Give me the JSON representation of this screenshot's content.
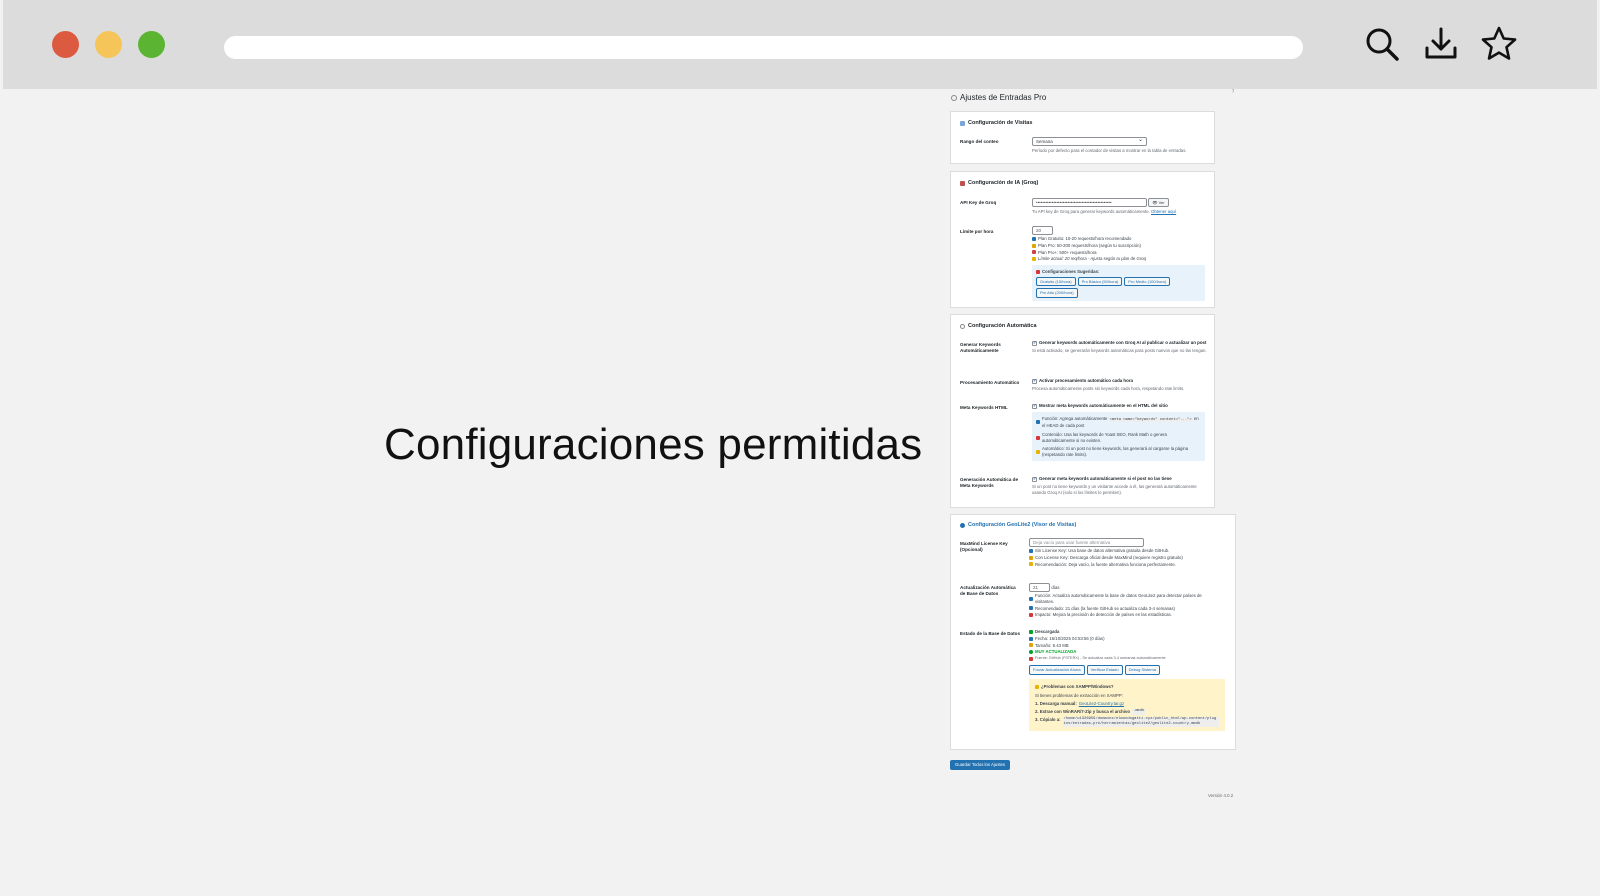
{
  "headline": "Configuraciones permitidas",
  "browser": {
    "icons": [
      "search-icon",
      "download-icon",
      "star-icon"
    ],
    "colors": {
      "close": "#dc5a3f",
      "minimize": "#f6c55a",
      "maximize": "#5bb532"
    }
  },
  "settings": {
    "title": "Ajustes de Entradas Pro",
    "visits": {
      "title": "Configuración de Visitas",
      "range_label": "Rango del conteo",
      "range_value": "Semana",
      "range_help": "Período por defecto para el contador de visitas a mostrar en la tabla de entradas."
    },
    "ia": {
      "title": "Configuración de IA (Groq)",
      "api_label": "API Key de Groq",
      "api_value": "••••••••••••••••••••••••••••••••••••••••••••••••",
      "show_button": "👁 Ver",
      "api_help": "Tu API key de Groq para generar keywords automáticamente.",
      "api_link": "Obtener aquí",
      "limit_label": "Límite por hora",
      "limit_value": "20",
      "plans": [
        "Plan Gratuito: 10-20 requests/hora recomendado",
        "Plan Pro: 50-200 requests/hora (según tu suscripción)",
        "Plan Pro+: 500+ requests/hora",
        "Límite actual: 20 req/hora - Ajusta según tu plan de Groq"
      ],
      "suggested_title": "Configuraciones Sugeridas:",
      "suggested": [
        "Gratuito (15/hora)",
        "Pro Básico (50/hora)",
        "Pro Medio (100/hora)",
        "Pro Alto (200/hora)"
      ]
    },
    "auto": {
      "title": "Configuración Automática",
      "gen_label": "Generar Keywords Automáticamente",
      "gen_check": "Generar keywords automáticamente con Groq AI al publicar o actualizar un post",
      "gen_help": "Si está activado, se generarán keywords automáticas para posts nuevos que no las tengan.",
      "proc_label": "Procesamiento Automático",
      "proc_check": "Activar procesamiento automático cada hora",
      "proc_help": "Procesa automáticamente posts sin keywords cada hora, respetando rate limits.",
      "meta_label": "Meta Keywords HTML",
      "meta_check": "Mostrar meta keywords automáticamente en el HTML del sitio",
      "meta_func_a": "Función: Agrega automáticamente",
      "meta_func_code": "<meta name=\"keywords\" content=\"...\">",
      "meta_func_b": "en el HEAD de cada post",
      "meta_content": "Contenido: Usa las keywords de Yoast SEO, Rank Math o genera automáticamente si no existen.",
      "meta_auto": "Automático: Si un post no tiene keywords, las generará al cargarse la página (respetando rate limits).",
      "genmeta_label": "Generación Automática de Meta Keywords",
      "genmeta_check": "Generar meta keywords automáticamente si el post no las tiene",
      "genmeta_help": "Si un post no tiene keywords y un visitante accede a él, las generará automáticamente usando Groq AI (solo si los límites lo permiten)."
    },
    "geo": {
      "title": "Configuración GeoLite2 (Visor de Visitas)",
      "license_label": "MaxMind License Key (Opcional)",
      "license_placeholder": "Deja vacío para usar fuente alternativa",
      "license_lines": [
        "Sin License Key: Usa base de datos alternativa gratuita desde GitHub.",
        "Con License Key: Descarga oficial desde MaxMind (requiere registro gratuito)",
        "Recomendación: Deja vacío, la fuente alternativa funciona perfectamente."
      ],
      "update_label": "Actualización Automática de Base de Datos",
      "update_value": "21",
      "update_unit": "días",
      "update_lines": [
        "Función: Actualiza automáticamente la base de datos GeoLite2 para detectar países de visitantes.",
        "Recomendado: 21 días (la fuente GitHub se actualiza cada 3-4 semanas)",
        "Impacto: Mejora la precisión de detección de países en las estadísticas."
      ],
      "status_label": "Estado de la Base de Datos",
      "status_lines": [
        "Descargada",
        "Fecha: 16/10/2025 04:53:56 (0 días)",
        "Tamaño: 9.43 MB",
        "MUY ACTUALIZADA",
        "Fuente: GitHub (P3TERX) - Se actualiza cada 3-4 semanas automáticamente"
      ],
      "buttons": [
        "Forzar Actualización Ahora",
        "Verificar Estado",
        "Debug Sistema"
      ],
      "xampp_title": "¿Problemas con XAMPP/Windows?",
      "xampp_intro": "Si tienes problemas de extracción en XAMPP:",
      "xampp_step1_a": "1. Descarga manual:",
      "xampp_step1_link": "GeoLite2-Country.tar.gz",
      "xampp_step2_a": "2. Extrae con WinRAR/7-Zip y busca el archivo",
      "xampp_step2_code": ".mmdb",
      "xampp_step3_a": "3. Cópialo a:",
      "xampp_step3_code": "/home/u1326959/domains/elmundogatti.xyz/public_html/wp-content/plugins/entradas-pro/herramientas/geolite2/geolite2-country.mmdb"
    },
    "save_button": "Guardar Todos los Ajustes",
    "version": "Versión 4.0.2"
  }
}
